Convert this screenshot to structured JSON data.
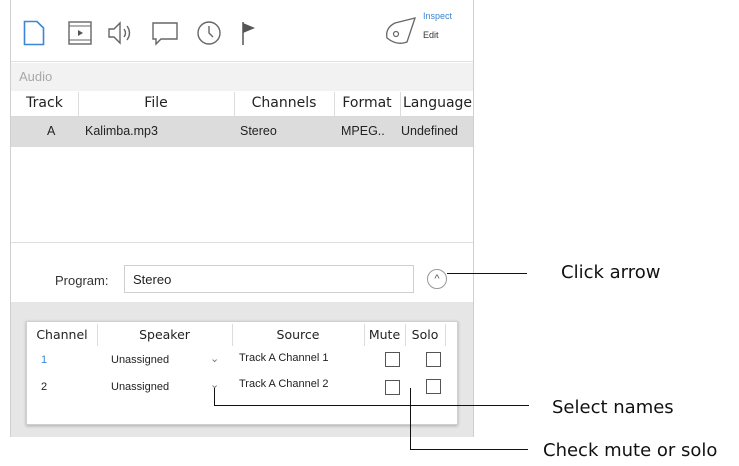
{
  "toolbar": {
    "icons": [
      "document-icon",
      "film-icon",
      "speaker-icon",
      "chat-bubble-icon",
      "clock-icon",
      "flag-icon"
    ],
    "inspect_label": "Inspect",
    "edit_label": "Edit",
    "accent_color": "#3b86d6"
  },
  "section": {
    "label": "Audio"
  },
  "table": {
    "headers": {
      "track": "Track",
      "file": "File",
      "channels": "Channels",
      "format": "Format",
      "language": "Language"
    },
    "rows": [
      {
        "track": "A",
        "file": "Kalimba.mp3",
        "channels": "Stereo",
        "format": "MPEG..",
        "language": "Undefined"
      }
    ]
  },
  "program": {
    "label": "Program:",
    "value": "Stereo",
    "arrow": "^"
  },
  "channels_table": {
    "headers": {
      "channel": "Channel",
      "speaker": "Speaker",
      "source": "Source",
      "mute": "Mute",
      "solo": "Solo"
    },
    "rows": [
      {
        "channel": "1",
        "speaker": "Unassigned",
        "source": "Track A Channel 1"
      },
      {
        "channel": "2",
        "speaker": "Unassigned",
        "source": "Track A Channel 2"
      }
    ]
  },
  "annotations": {
    "click_arrow": "Click arrow",
    "select_names": "Select names",
    "check_mute_solo": "Check mute or solo"
  }
}
